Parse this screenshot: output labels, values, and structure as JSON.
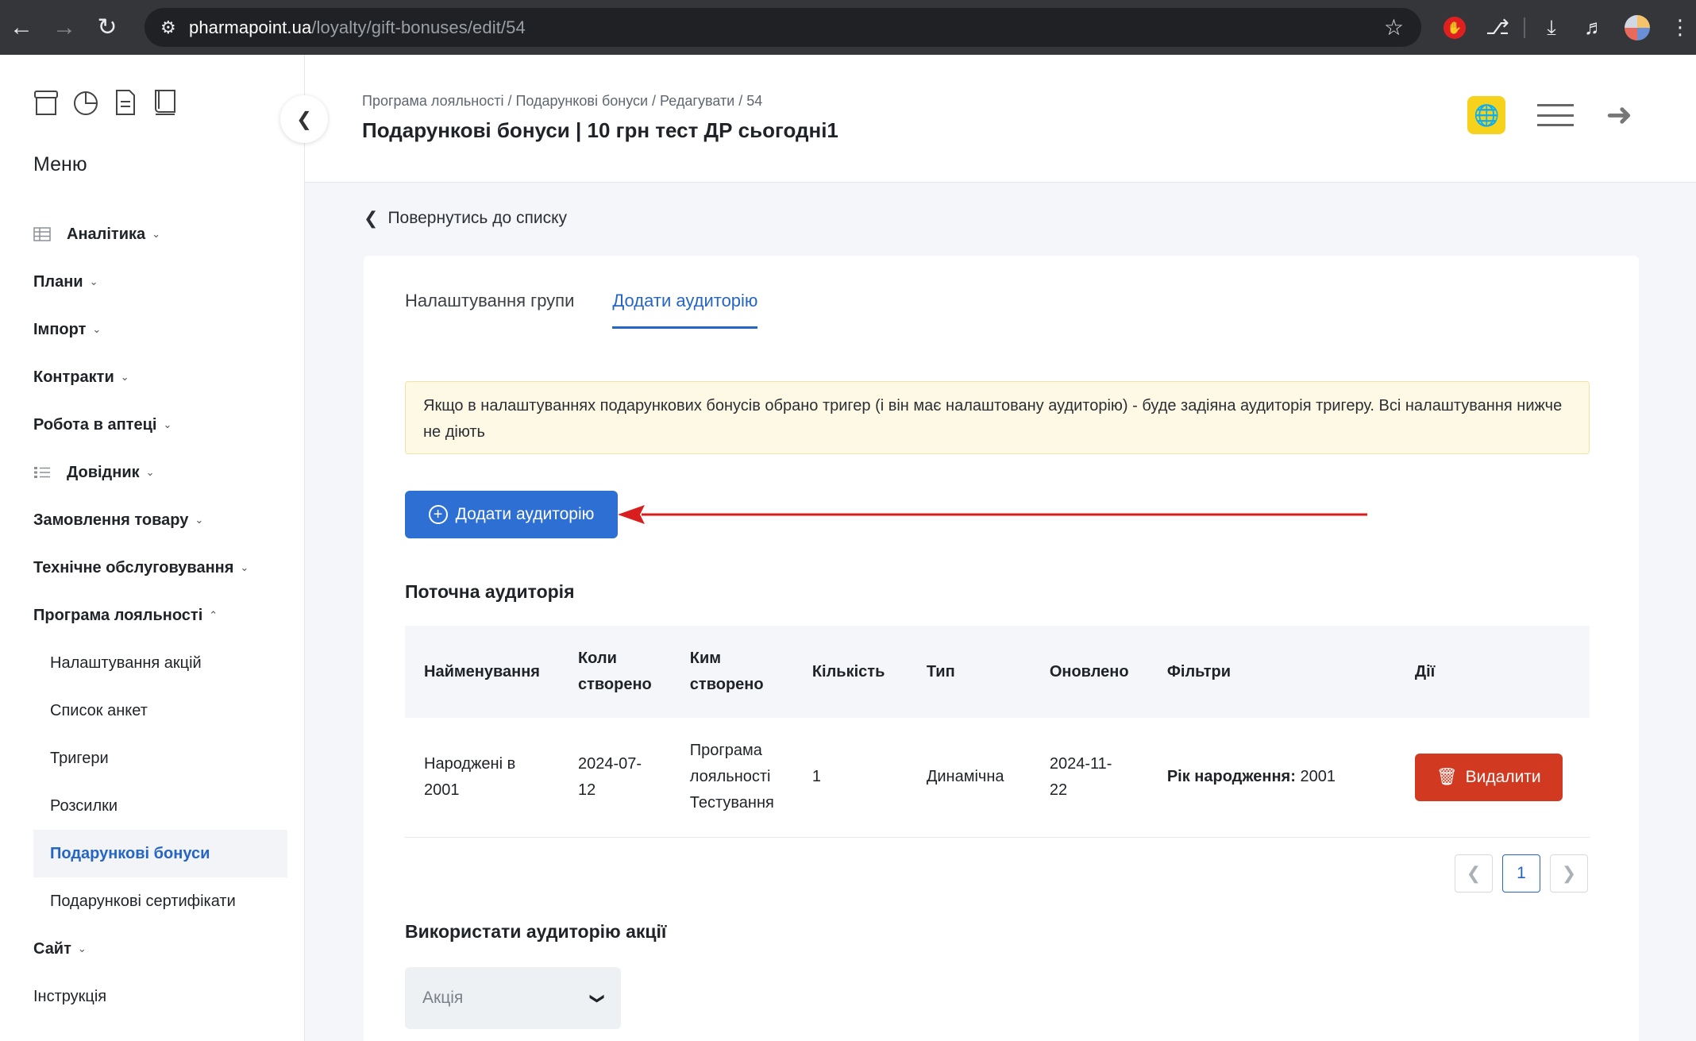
{
  "browser": {
    "url_host": "pharmapoint.ua",
    "url_path": "/loyalty/gift-bonuses/edit/54"
  },
  "sidebar": {
    "title": "Меню",
    "items": [
      {
        "label": "Аналітика",
        "icon": "grid-table-icon",
        "expandable": true
      },
      {
        "label": "Плани",
        "expandable": true
      },
      {
        "label": "Імпорт",
        "expandable": true
      },
      {
        "label": "Контракти",
        "expandable": true
      },
      {
        "label": "Робота в аптеці",
        "expandable": true
      },
      {
        "label": "Довідник",
        "icon": "list-icon",
        "expandable": true
      },
      {
        "label": "Замовлення товару",
        "expandable": true
      },
      {
        "label": "Технічне обслуговування",
        "expandable": true
      },
      {
        "label": "Програма лояльності",
        "expandable": true,
        "expanded": true
      },
      {
        "label": "Налаштування акцій",
        "sub": true
      },
      {
        "label": "Список анкет",
        "sub": true
      },
      {
        "label": "Тригери",
        "sub": true
      },
      {
        "label": "Розсилки",
        "sub": true
      },
      {
        "label": "Подарункові бонуси",
        "sub": true,
        "active": true
      },
      {
        "label": "Подарункові сертифікати",
        "sub": true
      },
      {
        "label": "Сайт",
        "expandable": true
      },
      {
        "label": "Інструкція"
      }
    ]
  },
  "header": {
    "breadcrumb": "Програма лояльності / Подарункові бонуси / Редагувати / 54",
    "title": "Подарункові бонуси | 10 грн тест ДР сьогодні1"
  },
  "main": {
    "back_link": "Повернутись до списку",
    "tabs": [
      {
        "label": "Налаштування групи",
        "active": false
      },
      {
        "label": "Додати аудиторію",
        "active": true
      }
    ],
    "notice": "Якщо в налаштуваннях подарункових бонусів обрано тригер (і він має налаштовану аудиторію) - буде задіяна аудиторія тригеру. Всі налаштування нижче не діють",
    "add_audience_label": "Додати аудиторію",
    "current_audience_title": "Поточна аудиторія",
    "table": {
      "headers": [
        "Найменування",
        "Коли створено",
        "Ким створено",
        "Кількість",
        "Тип",
        "Оновлено",
        "Фільтри",
        "Дії"
      ],
      "rows": [
        {
          "name": "Народжені в 2001",
          "created": "2024-07-12",
          "created_by": "Програма лояльності Тестування",
          "count": "1",
          "type": "Динамічна",
          "updated": "2024-11-22",
          "filter_label": "Рік народження:",
          "filter_value": "2001",
          "delete_label": "Видалити"
        }
      ]
    },
    "pagination": {
      "current": "1"
    },
    "use_promo_title": "Використати аудиторію акції",
    "promo_select_placeholder": "Акція"
  },
  "colors": {
    "primary": "#2e6fd3",
    "danger": "#d13a21",
    "notice_bg": "#fdf9e4",
    "accent_yellow": "#f6d21c",
    "annotation_arrow": "#d81e1e"
  }
}
